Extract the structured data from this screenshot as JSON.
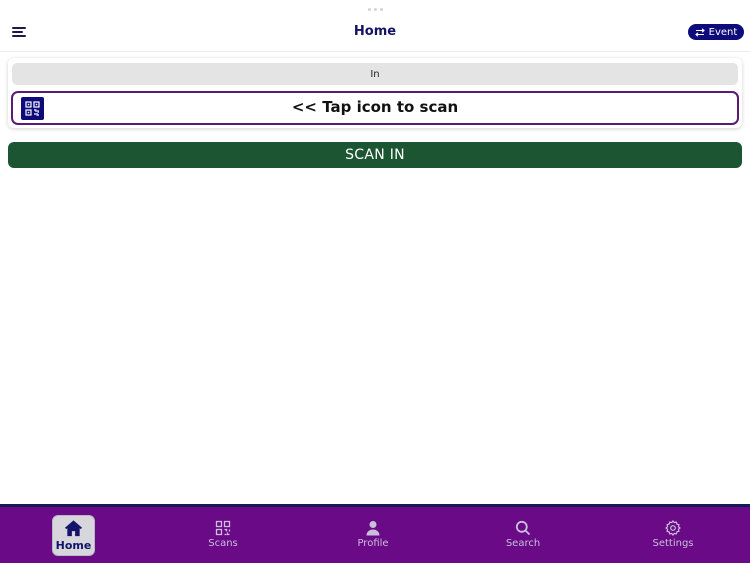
{
  "header": {
    "title": "Home",
    "menu_icon": "hamburger-icon",
    "event_button_label": "Event",
    "event_icon": "swap-arrows-icon"
  },
  "scan_panel": {
    "mode_label": "In",
    "qr_icon": "qr-code-icon",
    "hint": "<< Tap icon to scan"
  },
  "scan_button_label": "SCAN IN",
  "bottom_nav": {
    "items": [
      {
        "label": "Home",
        "icon": "home-icon",
        "active": true
      },
      {
        "label": "Scans",
        "icon": "qr-code-icon",
        "active": false
      },
      {
        "label": "Profile",
        "icon": "person-icon",
        "active": false
      },
      {
        "label": "Search",
        "icon": "search-icon",
        "active": false
      },
      {
        "label": "Settings",
        "icon": "gear-icon",
        "active": false
      }
    ]
  },
  "colors": {
    "brand_navy": "#0e0b7a",
    "title_navy": "#141463",
    "scan_border_purple": "#5a1a78",
    "scan_button_green": "#1c5532",
    "nav_background": "#6a0a86"
  }
}
